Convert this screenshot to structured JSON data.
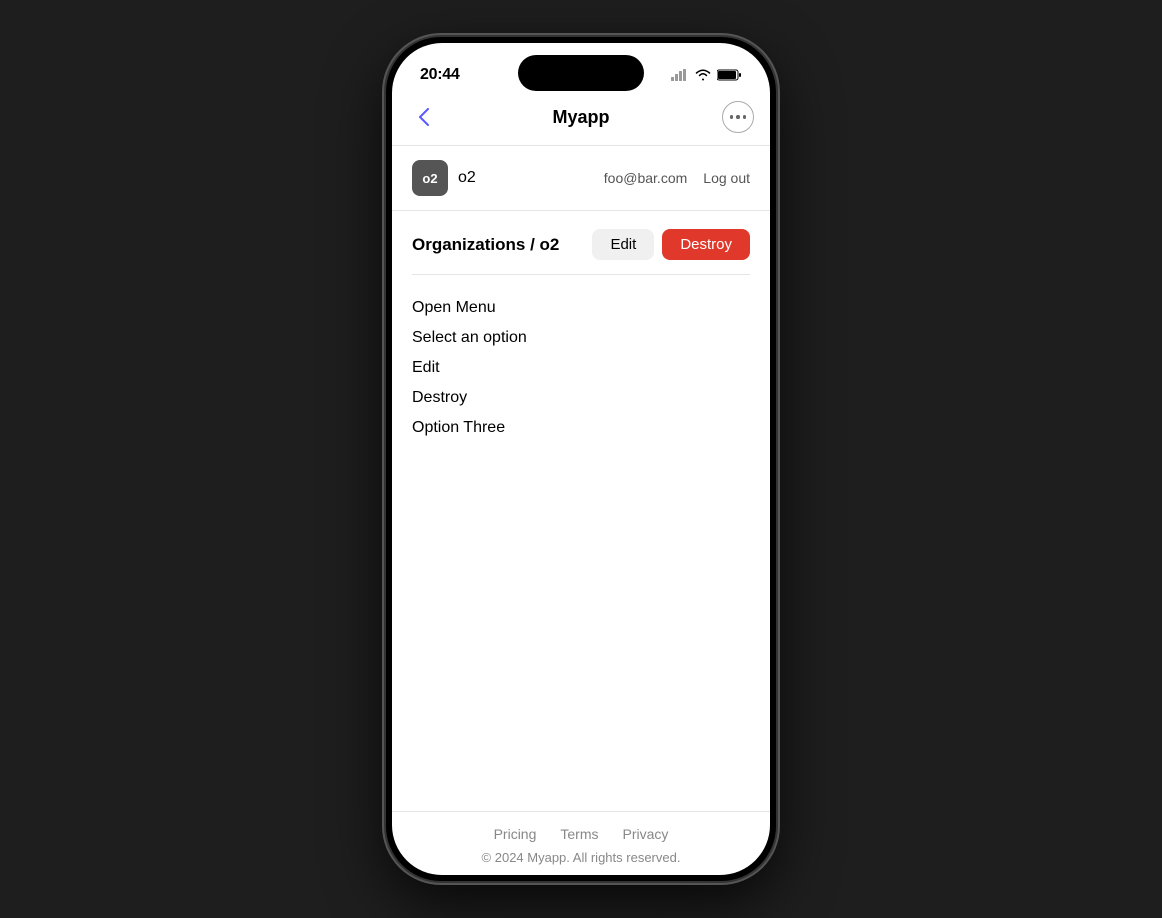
{
  "status_bar": {
    "time": "20:44"
  },
  "nav": {
    "title": "Myapp",
    "back_label": "Back",
    "menu_label": "More options"
  },
  "user_row": {
    "avatar_initials": "o2",
    "name": "o2",
    "email": "foo@bar.com",
    "logout_label": "Log out"
  },
  "breadcrumb": {
    "text": "Organizations / o2"
  },
  "actions": {
    "edit_label": "Edit",
    "destroy_label": "Destroy"
  },
  "menu": {
    "items": [
      {
        "label": "Open Menu"
      },
      {
        "label": "Select an option"
      },
      {
        "label": "Edit"
      },
      {
        "label": "Destroy"
      },
      {
        "label": "Option Three"
      }
    ]
  },
  "footer": {
    "links": [
      {
        "label": "Pricing"
      },
      {
        "label": "Terms"
      },
      {
        "label": "Privacy"
      }
    ],
    "copyright": "© 2024 Myapp. All rights reserved."
  }
}
